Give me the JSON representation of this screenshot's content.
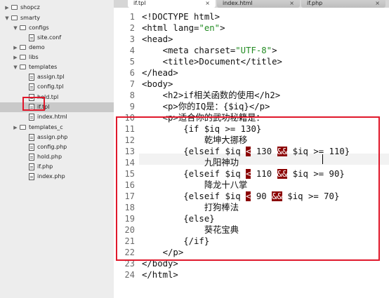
{
  "sidebar": {
    "items": [
      {
        "label": "shopcz",
        "kind": "folder",
        "expanded": false
      },
      {
        "label": "smarty",
        "kind": "folder",
        "expanded": true
      },
      {
        "label": "configs",
        "kind": "folder",
        "expanded": true
      },
      {
        "label": "site.conf",
        "kind": "file"
      },
      {
        "label": "demo",
        "kind": "folder",
        "expanded": false
      },
      {
        "label": "libs",
        "kind": "folder",
        "expanded": false
      },
      {
        "label": "templates",
        "kind": "folder",
        "expanded": true
      },
      {
        "label": "assign.tpl",
        "kind": "file"
      },
      {
        "label": "config.tpl",
        "kind": "file"
      },
      {
        "label": "hold.tpl",
        "kind": "file"
      },
      {
        "label": "if.tpl",
        "kind": "file",
        "selected": true
      },
      {
        "label": "index.html",
        "kind": "file"
      },
      {
        "label": "templates_c",
        "kind": "folder",
        "expanded": false
      },
      {
        "label": "assign.php",
        "kind": "file"
      },
      {
        "label": "config.php",
        "kind": "file"
      },
      {
        "label": "hold.php",
        "kind": "file"
      },
      {
        "label": "if.php",
        "kind": "file"
      },
      {
        "label": "index.php",
        "kind": "file"
      }
    ]
  },
  "tabs": [
    {
      "label": "if.tpl",
      "close": "×",
      "active": true
    },
    {
      "label": "index.html",
      "close": "×",
      "active": false
    },
    {
      "label": "if.php",
      "close": "×",
      "active": false
    }
  ],
  "editor": {
    "lines": [
      {
        "n": "1",
        "parts": [
          {
            "t": "<!DOCTYPE html>"
          }
        ]
      },
      {
        "n": "2",
        "parts": [
          {
            "t": "<html lang="
          },
          {
            "t": "\"en\"",
            "c": "str"
          },
          {
            "t": ">"
          }
        ]
      },
      {
        "n": "3",
        "parts": [
          {
            "t": "<head>"
          }
        ]
      },
      {
        "n": "4",
        "parts": [
          {
            "t": "    <meta charset="
          },
          {
            "t": "\"UTF-8\"",
            "c": "str"
          },
          {
            "t": ">"
          }
        ]
      },
      {
        "n": "5",
        "parts": [
          {
            "t": "    <title>Document</title>"
          }
        ]
      },
      {
        "n": "6",
        "parts": [
          {
            "t": "</head>"
          }
        ]
      },
      {
        "n": "7",
        "parts": [
          {
            "t": "<body>"
          }
        ]
      },
      {
        "n": "8",
        "parts": [
          {
            "t": "    <h2>if相关函数的使用</h2>"
          }
        ]
      },
      {
        "n": "9",
        "parts": [
          {
            "t": "    <p>你的IQ是：{$iq}</p>"
          }
        ]
      },
      {
        "n": "10",
        "parts": [
          {
            "t": "    <p>适合你的武功秘籍是："
          }
        ]
      },
      {
        "n": "11",
        "parts": [
          {
            "t": "        {if $iq >= 130}"
          }
        ]
      },
      {
        "n": "12",
        "parts": [
          {
            "t": "            乾坤大挪移"
          }
        ]
      },
      {
        "n": "13",
        "parts": [
          {
            "t": "        {elseif $iq "
          },
          {
            "t": "<",
            "c": "hl"
          },
          {
            "t": " 130 "
          },
          {
            "t": "&&",
            "c": "hl"
          },
          {
            "t": " $iq >= 110}"
          }
        ],
        "current": true
      },
      {
        "n": "14",
        "parts": [
          {
            "t": "            九阳神功"
          }
        ]
      },
      {
        "n": "15",
        "parts": [
          {
            "t": "        {elseif $iq "
          },
          {
            "t": "<",
            "c": "hl"
          },
          {
            "t": " 110 "
          },
          {
            "t": "&&",
            "c": "hl"
          },
          {
            "t": " $iq >= 90}"
          }
        ]
      },
      {
        "n": "16",
        "parts": [
          {
            "t": "            降龙十八掌"
          }
        ]
      },
      {
        "n": "17",
        "parts": [
          {
            "t": "        {elseif $iq "
          },
          {
            "t": "<",
            "c": "hl"
          },
          {
            "t": " 90 "
          },
          {
            "t": "&&",
            "c": "hl"
          },
          {
            "t": " $iq >= 70}"
          }
        ]
      },
      {
        "n": "18",
        "parts": [
          {
            "t": "            打狗棒法"
          }
        ]
      },
      {
        "n": "19",
        "parts": [
          {
            "t": "        {else}"
          }
        ]
      },
      {
        "n": "20",
        "parts": [
          {
            "t": "            葵花宝典"
          }
        ]
      },
      {
        "n": "21",
        "parts": [
          {
            "t": "        {/if}"
          }
        ]
      },
      {
        "n": "22",
        "parts": [
          {
            "t": "    </p>"
          }
        ]
      },
      {
        "n": "23",
        "parts": [
          {
            "t": "</body>"
          }
        ]
      },
      {
        "n": "24",
        "parts": [
          {
            "t": "</html>"
          }
        ]
      }
    ]
  },
  "colors": {
    "highlight": "#8b0000",
    "annotation_box": "#e0182b",
    "string": "#228b22"
  }
}
